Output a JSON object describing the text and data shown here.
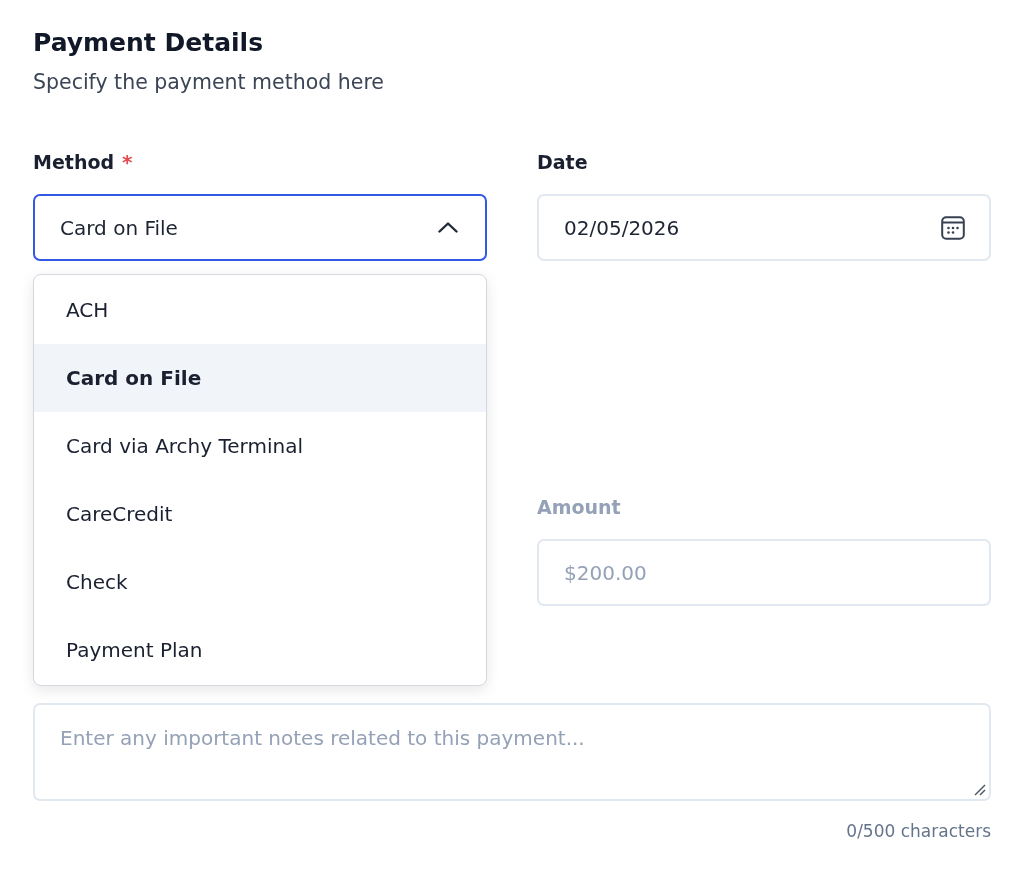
{
  "header": {
    "title": "Payment Details",
    "subtitle": "Specify the payment method here"
  },
  "method": {
    "label": "Method",
    "required_mark": "*",
    "value": "Card on File",
    "expanded": true,
    "options": [
      {
        "label": "ACH",
        "selected": false
      },
      {
        "label": "Card on File",
        "selected": true
      },
      {
        "label": "Card via Archy Terminal",
        "selected": false
      },
      {
        "label": "CareCredit",
        "selected": false
      },
      {
        "label": "Check",
        "selected": false
      },
      {
        "label": "Payment Plan",
        "selected": false
      }
    ]
  },
  "date": {
    "label": "Date",
    "value": "02/05/2026"
  },
  "amount": {
    "label": "Amount",
    "value": "$200.00",
    "disabled": true
  },
  "notes": {
    "placeholder": "Enter any important notes related to this payment...",
    "counter": "0/500 characters"
  }
}
